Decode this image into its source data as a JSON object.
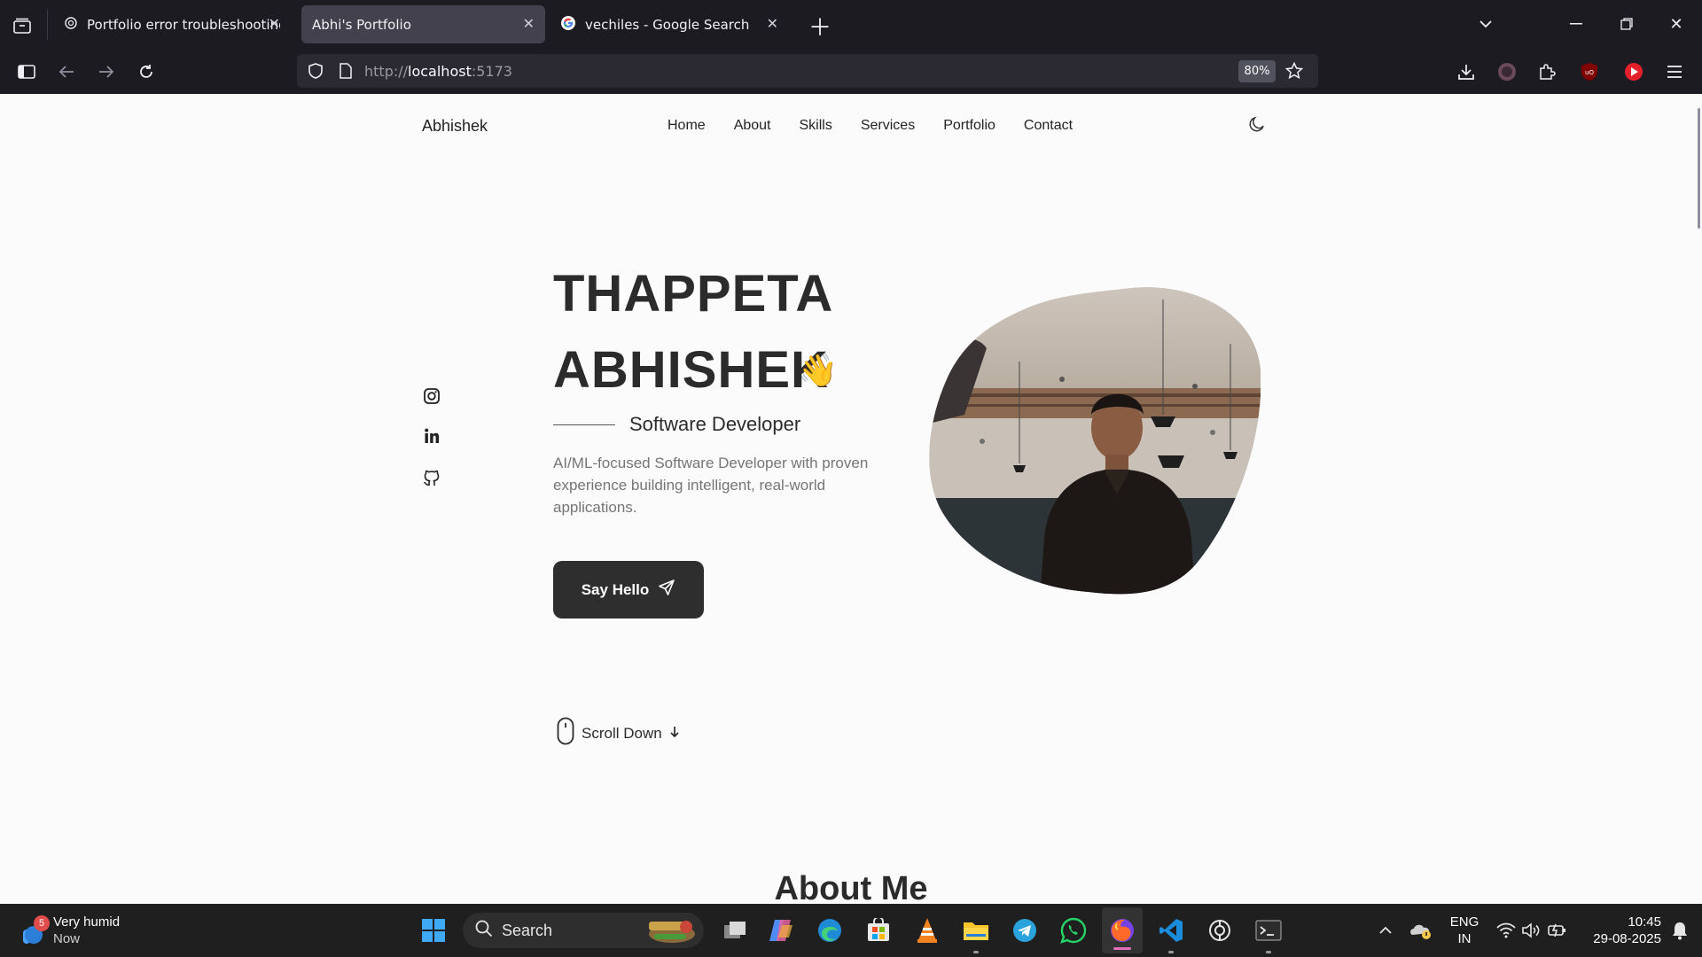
{
  "browser": {
    "tabs": [
      {
        "title": "Portfolio error troubleshooting",
        "icon": "openai-icon",
        "active": false
      },
      {
        "title": "Abhi's Portfolio",
        "icon": "none",
        "active": true
      },
      {
        "title": "vechiles - Google Search",
        "icon": "google-icon",
        "active": false
      }
    ],
    "url_prefix": "http://",
    "url_host": "localhost",
    "url_suffix": ":5173",
    "zoom": "80%"
  },
  "site": {
    "brand": "Abhishek",
    "nav": [
      "Home",
      "About",
      "Skills",
      "Services",
      "Portfolio",
      "Contact"
    ],
    "hero": {
      "name_line1": "THAPPETA",
      "name_line2": "ABHISHEK",
      "wave": "👋",
      "subtitle": "Software Developer",
      "description": "AI/ML-focused Software Developer with proven experience building intelligent, real-world applications.",
      "cta": "Say Hello",
      "scroll": "Scroll Down"
    },
    "about_heading": "About Me",
    "social": [
      "instagram-icon",
      "linkedin-icon",
      "github-icon"
    ]
  },
  "taskbar": {
    "weather_badge": "5",
    "weather_title": "Very humid",
    "weather_sub": "Now",
    "search_label": "Search",
    "lang_top": "ENG",
    "lang_bottom": "IN",
    "time": "10:45",
    "date": "29-08-2025"
  }
}
